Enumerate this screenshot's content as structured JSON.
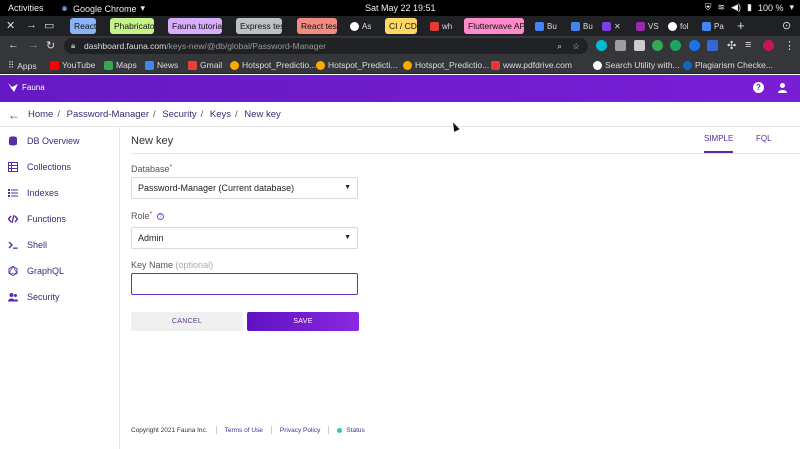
{
  "system": {
    "activities": "Activities",
    "app_name": "Google Chrome",
    "clock": "Sat May 22  19:51",
    "battery": "100 %"
  },
  "tabs": [
    {
      "label": "React",
      "color": "#8ab4f8"
    },
    {
      "label": "Phabricator",
      "color": "#c5f28a"
    },
    {
      "label": "Fauna tutorial",
      "color": "#d7aefb"
    },
    {
      "label": "Express test",
      "color": "#bdc1c6"
    },
    {
      "label": "React test",
      "color": "#f28b82"
    },
    {
      "label": "As"
    },
    {
      "label": "CI / CD",
      "color": "#fdd663"
    },
    {
      "label": "wh"
    },
    {
      "label": "Flutterwave API",
      "color": "#ff8bcb"
    },
    {
      "label": "Bu"
    },
    {
      "label": "Bu"
    },
    {
      "label": "VS"
    },
    {
      "label": "fol"
    },
    {
      "label": "Pa"
    }
  ],
  "address_bar": {
    "host": "dashboard.fauna.com",
    "path": "/keys-new/@db/global/Password-Manager"
  },
  "bookmarks": [
    {
      "label": "Apps"
    },
    {
      "label": "YouTube"
    },
    {
      "label": "Maps"
    },
    {
      "label": "News"
    },
    {
      "label": "Gmail"
    },
    {
      "label": "Hotspot_Predictio..."
    },
    {
      "label": "Hotspot_Predicti..."
    },
    {
      "label": "Hotspot_Predictio..."
    },
    {
      "label": "www.pdfdrive.com"
    },
    {
      "label": "Search Utility with..."
    },
    {
      "label": "Plagiarism Checke..."
    }
  ],
  "header": {
    "brand": "Fauna"
  },
  "breadcrumb": [
    "Home",
    "Password-Manager",
    "Security",
    "Keys",
    "New key"
  ],
  "sidebar": {
    "items": [
      {
        "label": "DB Overview",
        "icon": "database-icon"
      },
      {
        "label": "Collections",
        "icon": "collections-icon"
      },
      {
        "label": "Indexes",
        "icon": "list-icon"
      },
      {
        "label": "Functions",
        "icon": "code-icon"
      },
      {
        "label": "Shell",
        "icon": "terminal-icon"
      },
      {
        "label": "GraphQL",
        "icon": "graphql-icon"
      },
      {
        "label": "Security",
        "icon": "users-icon"
      }
    ]
  },
  "main": {
    "title": "New key",
    "mode_tabs": [
      "SIMPLE",
      "FQL"
    ],
    "database": {
      "label": "Database",
      "required": "*",
      "value": "Password-Manager (Current database)"
    },
    "role": {
      "label": "Role",
      "required": "*",
      "value": "Admin"
    },
    "key_name": {
      "label": "Key Name",
      "hint": "(optional)",
      "value": "",
      "placeholder": ""
    },
    "cancel": "CANCEL",
    "save": "SAVE"
  },
  "footer": {
    "copyright": "Copyright 2021 Fauna Inc.",
    "terms": "Terms of Use",
    "privacy": "Privacy Policy",
    "status": "Status"
  }
}
